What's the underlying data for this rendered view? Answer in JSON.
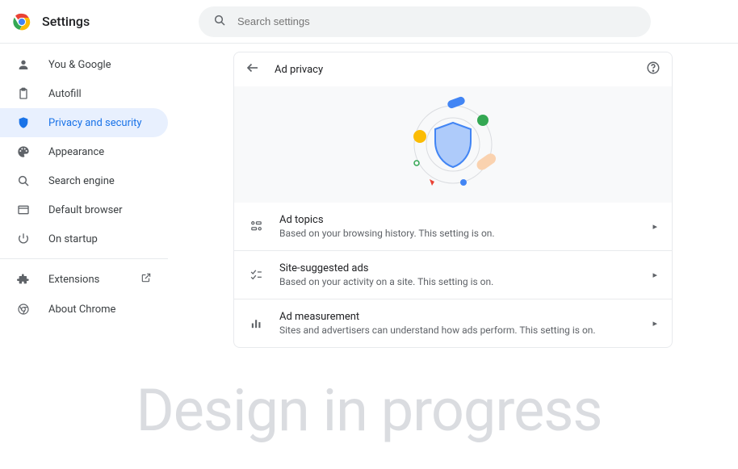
{
  "header": {
    "title": "Settings",
    "search_placeholder": "Search settings"
  },
  "sidebar": {
    "items": [
      {
        "icon": "person",
        "label": "You & Google"
      },
      {
        "icon": "clipboard",
        "label": "Autofill"
      },
      {
        "icon": "shield",
        "label": "Privacy and security",
        "active": true
      },
      {
        "icon": "palette",
        "label": "Appearance"
      },
      {
        "icon": "search",
        "label": "Search engine"
      },
      {
        "icon": "browser",
        "label": "Default browser"
      },
      {
        "icon": "power",
        "label": "On startup"
      }
    ],
    "after_sep": [
      {
        "icon": "extension",
        "label": "Extensions",
        "external": true
      },
      {
        "icon": "chrome",
        "label": "About Chrome"
      }
    ]
  },
  "page": {
    "title": "Ad privacy",
    "rows": [
      {
        "icon": "topics",
        "title": "Ad topics",
        "desc": "Based on your browsing history. This setting is on."
      },
      {
        "icon": "check-list",
        "title": "Site-suggested ads",
        "desc": "Based on your activity on a site. This setting is on."
      },
      {
        "icon": "bar-chart",
        "title": "Ad measurement",
        "desc": "Sites and advertisers can understand how ads perform. This setting is on."
      }
    ]
  },
  "watermark": "Design in progress"
}
